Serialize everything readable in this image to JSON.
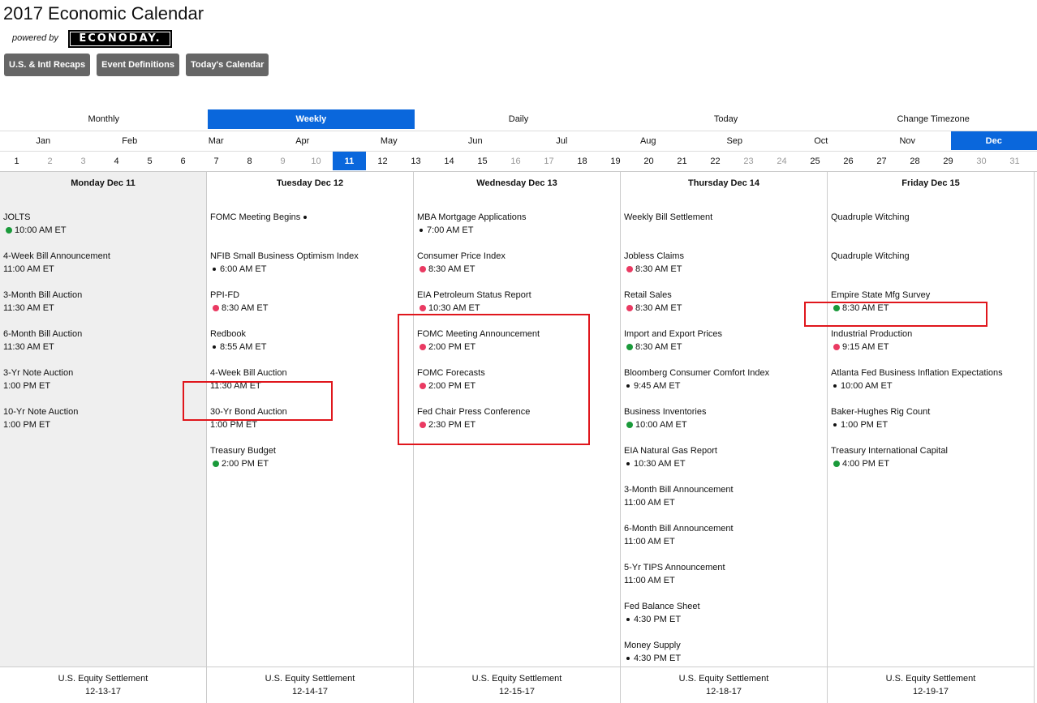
{
  "header": {
    "title": "2017 Economic Calendar",
    "powered_by": "powered by",
    "logo_text": "ECONODAY."
  },
  "buttons": [
    "U.S. & Intl Recaps",
    "Event Definitions",
    "Today's Calendar"
  ],
  "modes": [
    {
      "label": "Monthly",
      "active": false
    },
    {
      "label": "Weekly",
      "active": true
    },
    {
      "label": "Daily",
      "active": false
    },
    {
      "label": "Today",
      "active": false
    },
    {
      "label": "Change Timezone",
      "active": false
    }
  ],
  "months": [
    "Jan",
    "Feb",
    "Mar",
    "Apr",
    "May",
    "Jun",
    "Jul",
    "Aug",
    "Sep",
    "Oct",
    "Nov",
    "Dec"
  ],
  "active_month": "Dec",
  "day_numbers": [
    "1",
    "2",
    "3",
    "4",
    "5",
    "6",
    "7",
    "8",
    "9",
    "10",
    "11",
    "12",
    "13",
    "14",
    "15",
    "16",
    "17",
    "18",
    "19",
    "20",
    "21",
    "22",
    "23",
    "24",
    "25",
    "26",
    "27",
    "28",
    "29",
    "30",
    "31"
  ],
  "muted_days": [
    "2",
    "3",
    "9",
    "10",
    "16",
    "17",
    "23",
    "24",
    "30",
    "31"
  ],
  "active_day": "11",
  "colors": {
    "green": "#1a9a3a",
    "red": "#ea3a62",
    "black": "#111111",
    "accent": "#0a67dc",
    "highlight": "#e0161c"
  },
  "columns": [
    {
      "heading": "Monday Dec 11",
      "events": [
        {
          "name": "JOLTS",
          "time": "10:00 AM ET",
          "dot": "green"
        },
        {
          "name": "4-Week Bill Announcement",
          "time": "11:00 AM ET",
          "dot": ""
        },
        {
          "name": "3-Month Bill Auction",
          "time": "11:30 AM ET",
          "dot": ""
        },
        {
          "name": "6-Month Bill Auction",
          "time": "11:30 AM ET",
          "dot": ""
        },
        {
          "name": "3-Yr Note Auction",
          "time": "1:00 PM ET",
          "dot": ""
        },
        {
          "name": "10-Yr Note Auction",
          "time": "1:00 PM ET",
          "dot": ""
        }
      ],
      "footer": {
        "label": "U.S. Equity Settlement",
        "date": "12-13-17"
      }
    },
    {
      "heading": "Tuesday Dec 12",
      "events": [
        {
          "name": "FOMC Meeting Begins",
          "time": "",
          "dot": "",
          "name_dot": "black"
        },
        {
          "name": "NFIB Small Business Optimism Index",
          "time": "6:00 AM ET",
          "dot": "black"
        },
        {
          "name": "PPI-FD",
          "time": "8:30 AM ET",
          "dot": "red"
        },
        {
          "name": "Redbook",
          "time": "8:55 AM ET",
          "dot": "black"
        },
        {
          "name": "4-Week Bill Auction",
          "time": "11:30 AM ET",
          "dot": ""
        },
        {
          "name": "30-Yr Bond Auction",
          "time": "1:00 PM ET",
          "dot": ""
        },
        {
          "name": "Treasury Budget",
          "time": "2:00 PM ET",
          "dot": "green"
        }
      ],
      "footer": {
        "label": "U.S. Equity Settlement",
        "date": "12-14-17"
      }
    },
    {
      "heading": "Wednesday Dec 13",
      "events": [
        {
          "name": "MBA Mortgage Applications",
          "time": "7:00 AM ET",
          "dot": "black"
        },
        {
          "name": "Consumer Price Index",
          "time": "8:30 AM ET",
          "dot": "red"
        },
        {
          "name": "EIA Petroleum Status Report",
          "time": "10:30 AM ET",
          "dot": "red"
        },
        {
          "name": "FOMC Meeting Announcement",
          "time": "2:00 PM ET",
          "dot": "red"
        },
        {
          "name": "FOMC Forecasts",
          "time": "2:00 PM ET",
          "dot": "red"
        },
        {
          "name": "Fed Chair Press Conference",
          "time": "2:30 PM ET",
          "dot": "red"
        }
      ],
      "footer": {
        "label": "U.S. Equity Settlement",
        "date": "12-15-17"
      }
    },
    {
      "heading": "Thursday Dec 14",
      "events": [
        {
          "name": "Weekly Bill Settlement",
          "time": "",
          "dot": ""
        },
        {
          "name": "Jobless Claims",
          "time": "8:30 AM ET",
          "dot": "red"
        },
        {
          "name": "Retail Sales",
          "time": "8:30 AM ET",
          "dot": "red"
        },
        {
          "name": "Import and Export Prices",
          "time": "8:30 AM ET",
          "dot": "green"
        },
        {
          "name": "Bloomberg Consumer Comfort Index",
          "time": "9:45 AM ET",
          "dot": "black"
        },
        {
          "name": "Business Inventories",
          "time": "10:00 AM ET",
          "dot": "green"
        },
        {
          "name": "EIA Natural Gas Report",
          "time": "10:30 AM ET",
          "dot": "black"
        },
        {
          "name": "3-Month Bill Announcement",
          "time": "11:00 AM ET",
          "dot": ""
        },
        {
          "name": "6-Month Bill Announcement",
          "time": "11:00 AM ET",
          "dot": ""
        },
        {
          "name": "5-Yr TIPS Announcement",
          "time": "11:00 AM ET",
          "dot": ""
        },
        {
          "name": "Fed Balance Sheet",
          "time": "4:30 PM ET",
          "dot": "black"
        },
        {
          "name": "Money Supply",
          "time": "4:30 PM ET",
          "dot": "black"
        }
      ],
      "footer": {
        "label": "U.S. Equity Settlement",
        "date": "12-18-17"
      }
    },
    {
      "heading": "Friday Dec 15",
      "events": [
        {
          "name": "Quadruple Witching",
          "time": "",
          "dot": ""
        },
        {
          "name": "Quadruple Witching",
          "time": "",
          "dot": ""
        },
        {
          "name": "Empire State Mfg Survey",
          "time": "8:30 AM ET",
          "dot": "green"
        },
        {
          "name": "Industrial Production",
          "time": "9:15 AM ET",
          "dot": "red"
        },
        {
          "name": "Atlanta Fed Business Inflation Expectations",
          "time": "10:00 AM ET",
          "dot": "black"
        },
        {
          "name": "Baker-Hughes Rig Count",
          "time": "1:00 PM ET",
          "dot": "black"
        },
        {
          "name": "Treasury International Capital",
          "time": "4:00 PM ET",
          "dot": "green"
        }
      ],
      "footer": {
        "label": "U.S. Equity Settlement",
        "date": "12-19-17"
      }
    }
  ]
}
